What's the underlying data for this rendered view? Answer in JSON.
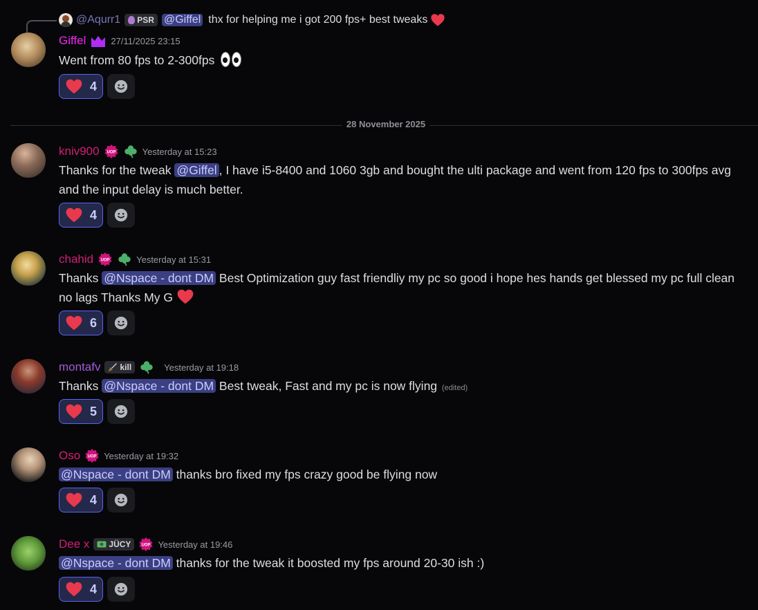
{
  "reply": {
    "author": "@Aqurr1",
    "badge": "PSR",
    "mention": "@Giffel",
    "text": "thx for helping me i got 200 fps+  best tweaks"
  },
  "date_divider": "28 November 2025",
  "messages": [
    {
      "username": "Giffel",
      "username_color": "#f026f4",
      "timestamp": "27/11/2025 23:15",
      "text": "Went from 80 fps to 2-300fps",
      "reaction_count": "4"
    },
    {
      "username": "kniv900",
      "username_color": "#d41e77",
      "timestamp": "Yesterday at 15:23",
      "text_prefix": "Thanks for the tweak ",
      "mention": "@Giffel",
      "text_suffix": ", I have i5-8400 and 1060 3gb and bought the ulti package and went from 120 fps to 300fps avg and the input delay is much better.",
      "reaction_count": "4"
    },
    {
      "username": "chahid",
      "username_color": "#d41e77",
      "timestamp": "Yesterday at 15:31",
      "text_prefix": "Thanks ",
      "mention": "@Nspace - dont DM",
      "text_suffix": "  Best Optimization guy fast friendliy my pc so good i hope hes hands get blessed my pc full clean no lags Thanks My G",
      "reaction_count": "6"
    },
    {
      "username": "montafv",
      "username_color": "#a45ad8",
      "badge": "kill",
      "timestamp": "Yesterday at 19:18",
      "text_prefix": "Thanks ",
      "mention": "@Nspace - dont DM",
      "text_suffix": " Best tweak, Fast and my pc is now flying",
      "edited": "(edited)",
      "reaction_count": "5"
    },
    {
      "username": "Oso",
      "username_color": "#d41e77",
      "timestamp": "Yesterday at 19:32",
      "mention": "@Nspace - dont DM",
      "text_suffix": " thanks bro fixed my fps crazy good be flying now",
      "reaction_count": "4"
    },
    {
      "username": "Dee x",
      "username_color": "#d41e77",
      "badge": "JÜCY",
      "timestamp": "Yesterday at 19:46",
      "mention": "@Nspace - dont DM",
      "text_suffix": "  thanks for the tweak it boosted my fps around 20-30 ish :)",
      "reaction_count": "4"
    }
  ],
  "uop_label": "UOP",
  "icons": {
    "heart": "heart-icon",
    "add_reaction": "smiley-icon",
    "uop": "uop-badge-icon",
    "clover": "clover-icon",
    "crown": "crown-icon",
    "eyes": "eyes-emoji",
    "sword": "sword-icon",
    "money": "money-icon"
  },
  "colors": {
    "background": "#070709",
    "mention_bg": "#3b3f83",
    "mention_text": "#c9cdfb",
    "reaction_border": "#5865f2",
    "heart": "#e8394d"
  }
}
